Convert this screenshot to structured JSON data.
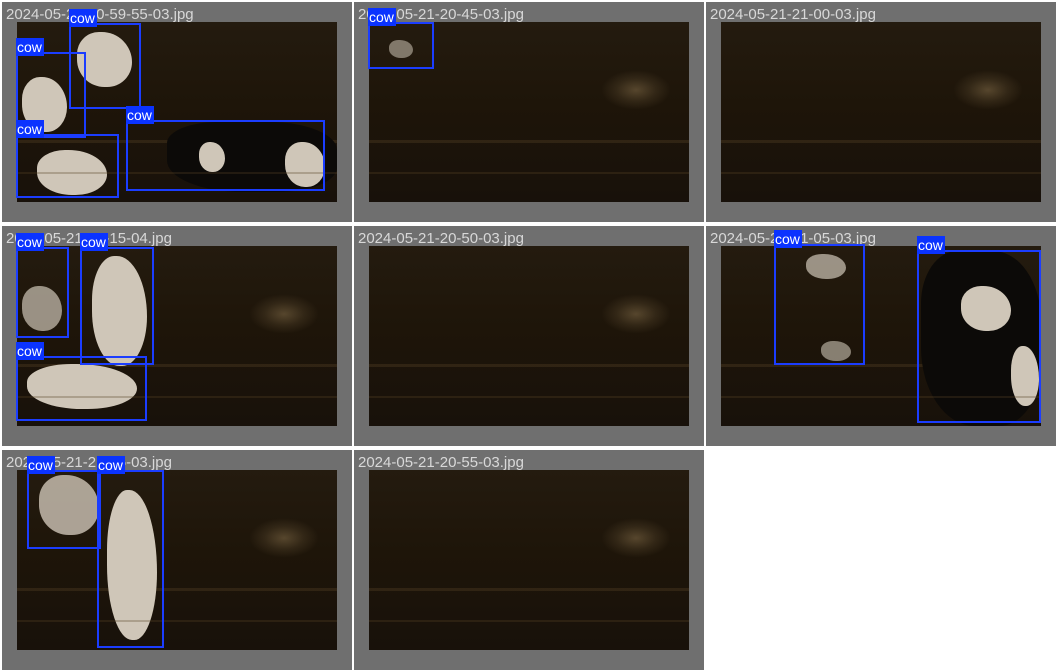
{
  "grid": {
    "tiles": [
      {
        "filename": "2024-05-21-20-59-55-03.jpg",
        "detections": [
          {
            "label": "cow"
          },
          {
            "label": "cow"
          },
          {
            "label": "cow"
          },
          {
            "label": "cow"
          }
        ]
      },
      {
        "filename": "2024-05-21-20-45-03.jpg",
        "detections": [
          {
            "label": "cow"
          }
        ]
      },
      {
        "filename": "2024-05-21-21-00-03.jpg",
        "detections": []
      },
      {
        "filename": "2024-05-21-21-15-04.jpg",
        "detections": [
          {
            "label": "cow"
          },
          {
            "label": "cow"
          },
          {
            "label": "cow"
          }
        ]
      },
      {
        "filename": "2024-05-21-20-50-03.jpg",
        "detections": []
      },
      {
        "filename": "2024-05-21-21-05-03.jpg",
        "detections": [
          {
            "label": "cow"
          },
          {
            "label": "cow"
          }
        ]
      },
      {
        "filename": "2024-05-21-21-05-03.jpg",
        "detections": [
          {
            "label": "cow"
          },
          {
            "label": "cow"
          }
        ]
      },
      {
        "filename": "2024-05-21-20-55-03.jpg",
        "detections": []
      }
    ]
  },
  "colors": {
    "tile_background": "#6f6f6f",
    "box_border": "#1b3dff",
    "label_background": "#0b33ff",
    "label_text": "#ffffff",
    "filename_text": "#d8d8d8"
  }
}
